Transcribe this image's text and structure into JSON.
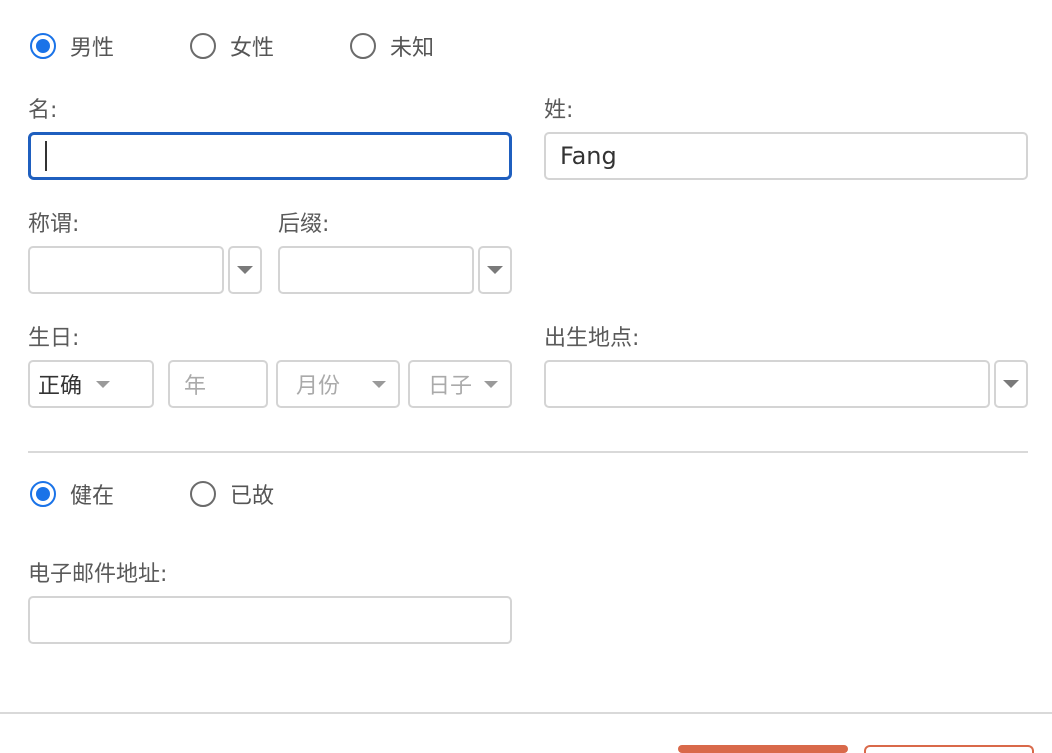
{
  "gender": {
    "options": [
      {
        "label": "男性",
        "selected": true
      },
      {
        "label": "女性",
        "selected": false
      },
      {
        "label": "未知",
        "selected": false
      }
    ]
  },
  "name": {
    "given_label": "名:",
    "given_value": "",
    "surname_label": "姓:",
    "surname_value": "Fang"
  },
  "title": {
    "label": "称谓:",
    "value": ""
  },
  "suffix": {
    "label": "后缀:",
    "value": ""
  },
  "birth": {
    "date_label": "生日:",
    "precision": "正确",
    "year_placeholder": "年",
    "month_placeholder": "月份",
    "day_placeholder": "日子",
    "place_label": "出生地点:",
    "place_value": ""
  },
  "status": {
    "options": [
      {
        "label": "健在",
        "selected": true
      },
      {
        "label": "已故",
        "selected": false
      }
    ]
  },
  "email": {
    "label": "电子邮件地址:",
    "value": ""
  },
  "colors": {
    "accent": "#1a73e8",
    "focus_border": "#1f5fbf",
    "button": "#d9694a"
  }
}
